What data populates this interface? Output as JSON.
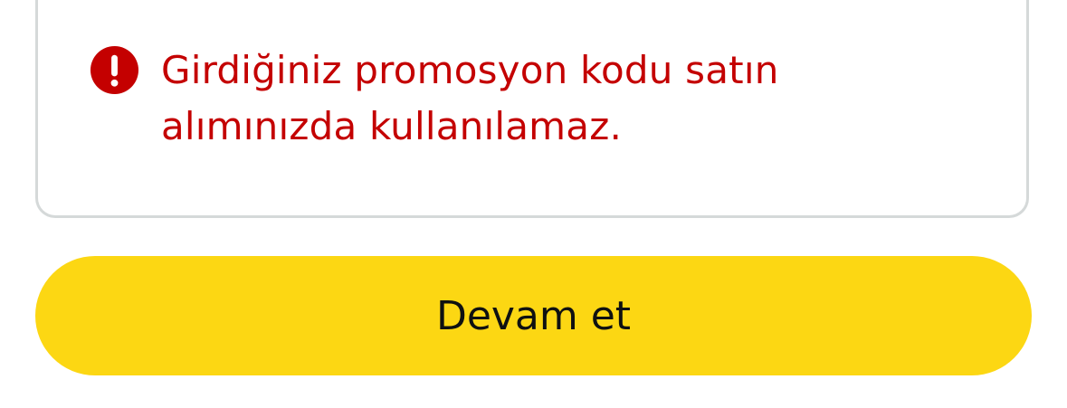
{
  "alert": {
    "icon": "exclamation-circle-icon",
    "icon_color": "#c40000",
    "message": "Girdiğiniz promosyon kodu satın alımınızda kullanılamaz.",
    "text_color": "#c40000"
  },
  "actions": {
    "continue_label": "Devam et",
    "button_color": "#fcd713"
  }
}
